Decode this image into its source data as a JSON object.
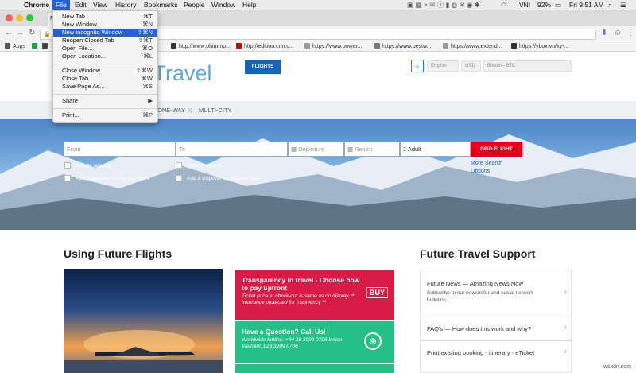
{
  "menubar": {
    "apple": "",
    "items": [
      "Chrome",
      "File",
      "Edit",
      "View",
      "History",
      "Bookmarks",
      "People",
      "Window",
      "Help"
    ],
    "status": {
      "ime": "VNI",
      "battery": "92%",
      "clock": "Fri 9:51 AM"
    }
  },
  "browser": {
    "tab_title": "F",
    "bookmarks": [
      "Apps",
      "http://www.phimmo...",
      "http://edition.cnn.c...",
      "https://www.power...",
      "https://www.bestw...",
      "https://www.extend...",
      "https://ybox.vn/ky-..."
    ]
  },
  "file_menu": {
    "items": [
      {
        "label": "New Tab",
        "shortcut": "⌘T"
      },
      {
        "label": "New Window",
        "shortcut": "⌘N"
      },
      {
        "label": "New Incognito Window",
        "shortcut": "⇧⌘N"
      },
      {
        "label": "Reopen Closed Tab",
        "shortcut": "⇧⌘T"
      },
      {
        "label": "Open File...",
        "shortcut": "⌘O"
      },
      {
        "label": "Open Location...",
        "shortcut": "⌘L"
      },
      {
        "label": "Close Window",
        "shortcut": "⇧⌘W"
      },
      {
        "label": "Close Tab",
        "shortcut": "⌘W"
      },
      {
        "label": "Save Page As...",
        "shortcut": "⌘S"
      },
      {
        "label": "Share",
        "shortcut": "▶"
      },
      {
        "label": "Print...",
        "shortcut": "⌘P"
      }
    ],
    "highlighted": "New Incognito Window"
  },
  "site": {
    "logo": "e.Travel",
    "flights_btn": "FLIGHTS",
    "lang": "English",
    "currency": "USD",
    "crypto": "Bitcoin - BTC",
    "nav": [
      "ONE-WAY",
      "MULTI-CITY"
    ],
    "form": {
      "from": "From",
      "to": "To",
      "departure": "Departure",
      "return": "Return",
      "passengers": "1 Adult",
      "find": "FIND FLIGHT",
      "nearby1": "Nearby airports",
      "nearby2": "Nearby airports",
      "stop1": "Add a stopover on the way there",
      "stop2": "Add a stopover on the way back",
      "more": "More Search Options"
    },
    "section_left": "Using Future Flights",
    "section_right": "Future Travel Support",
    "cards": [
      {
        "title": "Transparency in travel - Choose how to pay upfront",
        "sub": "Ticket price at check-out is same as on display ** Insurance protected for Insolvency **",
        "color": "#d91c46",
        "badge": "BUY"
      },
      {
        "title": "Have a Question? Call Us!",
        "sub": "Worldwide hotline: +84 28 3999 0706 Inside Vietnam: 028 3999 0706",
        "color": "#23c187"
      }
    ],
    "support": [
      {
        "title": "Future News — Amazing News Now",
        "sub": "Subscribe to our newsletter and social network bulletins"
      },
      {
        "title": "FAQ's — How does this work and why?",
        "sub": ""
      },
      {
        "title": "Print existing booking - itinerary - eTicket",
        "sub": ""
      }
    ]
  },
  "watermark": "wsxdn.com"
}
